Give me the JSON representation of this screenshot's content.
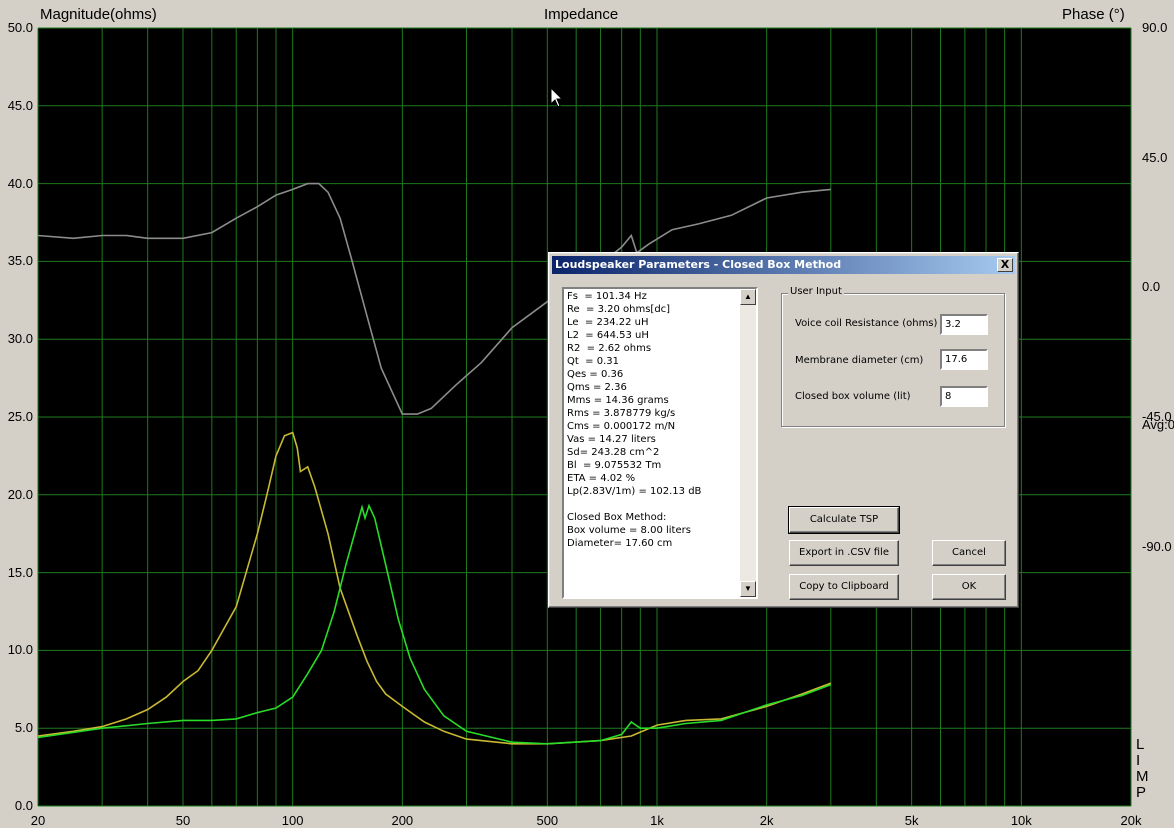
{
  "chart_data": {
    "type": "line",
    "title": "Impedance",
    "ylabel_left": "Magnitude(ohms)",
    "ylabel_right": "Phase (°)",
    "x_scale": "log",
    "xlim": [
      20,
      20000
    ],
    "ylim_left": [
      0,
      50
    ],
    "ylim_right": [
      -180,
      90
    ],
    "grid": true,
    "background": "#000000",
    "grid_color": "#1e7a1e",
    "x_tick_labels": [
      "20",
      "50",
      "100",
      "200",
      "500",
      "1k",
      "2k",
      "5k",
      "10k",
      "20k"
    ],
    "left_tick_labels": [
      "50.0",
      "45.0",
      "40.0",
      "35.0",
      "30.0",
      "25.0",
      "20.0",
      "15.0",
      "10.0",
      "5.0",
      "0.0"
    ],
    "right_tick_labels": [
      "90.0",
      "45.0",
      "0.0",
      "-45.0",
      "-90.0"
    ],
    "avg_label": "Avg:0",
    "side_letters": [
      "L",
      "I",
      "M",
      "P"
    ],
    "series": [
      {
        "color": "#c8b832",
        "axis": "left",
        "points": [
          [
            20,
            4.5
          ],
          [
            25,
            4.8
          ],
          [
            30,
            5.1
          ],
          [
            35,
            5.6
          ],
          [
            40,
            6.2
          ],
          [
            45,
            7.0
          ],
          [
            50,
            8.0
          ],
          [
            55,
            8.7
          ],
          [
            60,
            10.0
          ],
          [
            70,
            12.8
          ],
          [
            80,
            17.5
          ],
          [
            85,
            20.0
          ],
          [
            90,
            22.5
          ],
          [
            95,
            23.8
          ],
          [
            100,
            24.0
          ],
          [
            103,
            23.0
          ],
          [
            105,
            21.5
          ],
          [
            110,
            21.8
          ],
          [
            115,
            20.5
          ],
          [
            125,
            17.5
          ],
          [
            135,
            14.0
          ],
          [
            150,
            11.0
          ],
          [
            160,
            9.3
          ],
          [
            170,
            8.0
          ],
          [
            180,
            7.2
          ],
          [
            200,
            6.4
          ],
          [
            230,
            5.4
          ],
          [
            260,
            4.8
          ],
          [
            300,
            4.3
          ],
          [
            400,
            4.0
          ],
          [
            500,
            4.0
          ],
          [
            700,
            4.2
          ],
          [
            850,
            4.5
          ],
          [
            1000,
            5.2
          ],
          [
            1200,
            5.5
          ],
          [
            1500,
            5.6
          ],
          [
            2000,
            6.4
          ],
          [
            2500,
            7.2
          ],
          [
            3000,
            7.9
          ]
        ]
      },
      {
        "color": "#28dc28",
        "axis": "left",
        "points": [
          [
            20,
            4.4
          ],
          [
            30,
            5.0
          ],
          [
            40,
            5.3
          ],
          [
            50,
            5.5
          ],
          [
            60,
            5.5
          ],
          [
            70,
            5.6
          ],
          [
            80,
            6.0
          ],
          [
            90,
            6.3
          ],
          [
            100,
            7.0
          ],
          [
            110,
            8.5
          ],
          [
            120,
            10.0
          ],
          [
            130,
            12.5
          ],
          [
            140,
            15.5
          ],
          [
            150,
            18.0
          ],
          [
            155,
            19.2
          ],
          [
            158,
            18.5
          ],
          [
            162,
            19.3
          ],
          [
            168,
            18.5
          ],
          [
            180,
            15.5
          ],
          [
            195,
            12.0
          ],
          [
            210,
            9.5
          ],
          [
            230,
            7.5
          ],
          [
            260,
            5.8
          ],
          [
            300,
            4.8
          ],
          [
            400,
            4.1
          ],
          [
            500,
            4.0
          ],
          [
            700,
            4.2
          ],
          [
            800,
            4.6
          ],
          [
            850,
            5.4
          ],
          [
            900,
            5.0
          ],
          [
            1000,
            5.0
          ],
          [
            1200,
            5.3
          ],
          [
            1500,
            5.5
          ],
          [
            2000,
            6.5
          ],
          [
            2500,
            7.1
          ],
          [
            3000,
            7.8
          ]
        ]
      },
      {
        "color": "#8c8c8c",
        "axis": "right",
        "points": [
          [
            20,
            18
          ],
          [
            25,
            17
          ],
          [
            30,
            18
          ],
          [
            35,
            18
          ],
          [
            40,
            17
          ],
          [
            45,
            17
          ],
          [
            50,
            17
          ],
          [
            60,
            19
          ],
          [
            70,
            24
          ],
          [
            80,
            28
          ],
          [
            90,
            32
          ],
          [
            100,
            34
          ],
          [
            110,
            36
          ],
          [
            118,
            36
          ],
          [
            125,
            33
          ],
          [
            135,
            24
          ],
          [
            145,
            10
          ],
          [
            160,
            -10
          ],
          [
            175,
            -28
          ],
          [
            200,
            -44
          ],
          [
            220,
            -44
          ],
          [
            240,
            -42
          ],
          [
            280,
            -34
          ],
          [
            330,
            -26
          ],
          [
            400,
            -14
          ],
          [
            500,
            -5
          ],
          [
            600,
            2
          ],
          [
            700,
            8
          ],
          [
            800,
            14
          ],
          [
            850,
            18
          ],
          [
            880,
            12
          ],
          [
            950,
            15
          ],
          [
            1100,
            20
          ],
          [
            1300,
            22
          ],
          [
            1600,
            25
          ],
          [
            2000,
            31
          ],
          [
            2500,
            33
          ],
          [
            3000,
            34
          ]
        ]
      }
    ]
  },
  "dialog": {
    "title": "Loudspeaker Parameters - Closed Box Method",
    "close_label": "X",
    "results_lines": "Fs  = 101.34 Hz\nRe  = 3.20 ohms[dc]\nLe  = 234.22 uH\nL2  = 644.53 uH\nR2  = 2.62 ohms\nQt  = 0.31\nQes = 0.36\nQms = 2.36\nMms = 14.36 grams\nRms = 3.878779 kg/s\nCms = 0.000172 m/N\nVas = 14.27 liters\nSd= 243.28 cm^2\nBl  = 9.075532 Tm\nETA = 4.02 %\nLp(2.83V/1m) = 102.13 dB\n\nClosed Box Method:\nBox volume = 8.00 liters\nDiameter= 17.60 cm",
    "group_title": "User Input",
    "voice_coil_label": "Voice coil Resistance (ohms)",
    "voice_coil_value": "3.2",
    "membrane_label": "Membrane diameter (cm)",
    "membrane_value": "17.6",
    "box_volume_label": "Closed box volume (lit)",
    "box_volume_value": "8",
    "calculate_label": "Calculate TSP",
    "export_label": "Export in .CSV file",
    "cancel_label": "Cancel",
    "clipboard_label": "Copy to Clipboard",
    "ok_label": "OK"
  }
}
